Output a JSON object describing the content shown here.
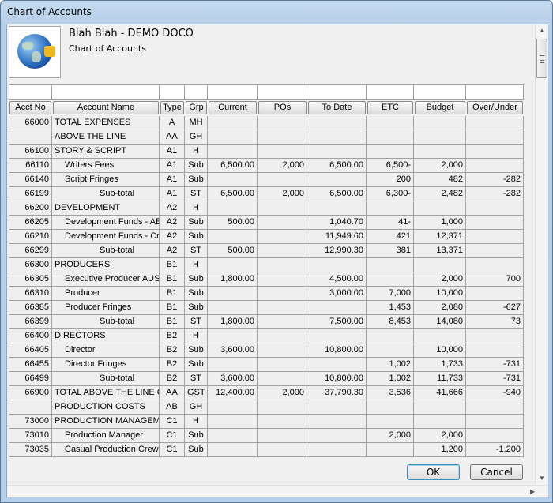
{
  "window": {
    "title": "Chart of Accounts"
  },
  "header": {
    "company": "Blah Blah - DEMO DOCO",
    "subtitle": "Chart of Accounts",
    "logo": "globe-puzzle-icon"
  },
  "table": {
    "columns": [
      "Acct No",
      "Account Name",
      "Type",
      "Grp",
      "Current",
      "POs",
      "To Date",
      "ETC",
      "Budget",
      "Over/Under"
    ],
    "rows": [
      [
        "66000",
        "TOTAL EXPENSES",
        "A",
        "MH",
        "",
        "",
        "",
        "",
        "",
        ""
      ],
      [
        "",
        "ABOVE THE LINE",
        "AA",
        "GH",
        "",
        "",
        "",
        "",
        "",
        ""
      ],
      [
        "66100",
        "STORY & SCRIPT",
        "A1",
        "H",
        "",
        "",
        "",
        "",
        "",
        ""
      ],
      [
        "66110",
        "Writers Fees",
        "A1",
        "Sub",
        "6,500.00",
        "2,000",
        "6,500.00",
        "6,500-",
        "2,000",
        ""
      ],
      [
        "66140",
        "Script Fringes",
        "A1",
        "Sub",
        "",
        "",
        "",
        "200",
        "482",
        "-282"
      ],
      [
        "66199",
        "Sub-total",
        "A1",
        "ST",
        "6,500.00",
        "2,000",
        "6,500.00",
        "6,300-",
        "2,482",
        "-282"
      ],
      [
        "66200",
        "DEVELOPMENT",
        "A2",
        "H",
        "",
        "",
        "",
        "",
        "",
        ""
      ],
      [
        "66205",
        "Development Funds - ABC",
        "A2",
        "Sub",
        "500.00",
        "",
        "1,040.70",
        "41-",
        "1,000",
        ""
      ],
      [
        "66210",
        "Development Funds - Crowd",
        "A2",
        "Sub",
        "",
        "",
        "11,949.60",
        "421",
        "12,371",
        ""
      ],
      [
        "66299",
        "Sub-total",
        "A2",
        "ST",
        "500.00",
        "",
        "12,990.30",
        "381",
        "13,371",
        ""
      ],
      [
        "66300",
        "PRODUCERS",
        "B1",
        "H",
        "",
        "",
        "",
        "",
        "",
        ""
      ],
      [
        "66305",
        "Executive Producer AUS",
        "B1",
        "Sub",
        "1,800.00",
        "",
        "4,500.00",
        "",
        "2,000",
        "700"
      ],
      [
        "66310",
        "Producer",
        "B1",
        "Sub",
        "",
        "",
        "3,000.00",
        "7,000",
        "10,000",
        ""
      ],
      [
        "66385",
        "Producer Fringes",
        "B1",
        "Sub",
        "",
        "",
        "",
        "1,453",
        "2,080",
        "-627"
      ],
      [
        "66399",
        "Sub-total",
        "B1",
        "ST",
        "1,800.00",
        "",
        "7,500.00",
        "8,453",
        "14,080",
        "73"
      ],
      [
        "66400",
        "DIRECTORS",
        "B2",
        "H",
        "",
        "",
        "",
        "",
        "",
        ""
      ],
      [
        "66405",
        "Director",
        "B2",
        "Sub",
        "3,600.00",
        "",
        "10,800.00",
        "",
        "10,000",
        ""
      ],
      [
        "66455",
        "Director Fringes",
        "B2",
        "Sub",
        "",
        "",
        "",
        "1,002",
        "1,733",
        "-731"
      ],
      [
        "66499",
        "Sub-total",
        "B2",
        "ST",
        "3,600.00",
        "",
        "10,800.00",
        "1,002",
        "11,733",
        "-731"
      ],
      [
        "66900",
        "TOTAL ABOVE THE LINE COST",
        "AA",
        "GST",
        "12,400.00",
        "2,000",
        "37,790.30",
        "3,536",
        "41,666",
        "-940"
      ],
      [
        "",
        "PRODUCTION COSTS",
        "AB",
        "GH",
        "",
        "",
        "",
        "",
        "",
        ""
      ],
      [
        "73000",
        "PRODUCTION MANAGEMENT",
        "C1",
        "H",
        "",
        "",
        "",
        "",
        "",
        ""
      ],
      [
        "73010",
        "Production Manager",
        "C1",
        "Sub",
        "",
        "",
        "",
        "2,000",
        "2,000",
        ""
      ],
      [
        "73035",
        "Casual Production Crew",
        "C1",
        "Sub",
        "",
        "",
        "",
        "",
        "1,200",
        "-1,200"
      ]
    ]
  },
  "buttons": {
    "ok": "OK",
    "cancel": "Cancel"
  }
}
